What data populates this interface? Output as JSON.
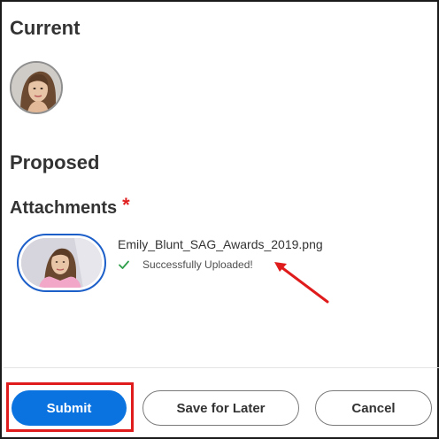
{
  "current": {
    "heading": "Current"
  },
  "proposed": {
    "heading": "Proposed"
  },
  "attachments": {
    "label": "Attachments",
    "required_marker": "*",
    "file_name": "Emily_Blunt_SAG_Awards_2019.png",
    "status": "Successfully Uploaded!"
  },
  "footer": {
    "submit_label": "Submit",
    "save_label": "Save for Later",
    "cancel_label": "Cancel"
  },
  "colors": {
    "primary": "#0b73e0",
    "highlight": "#e01b1b",
    "success": "#2e9e4a",
    "thumb_border": "#1d5fc9"
  },
  "icons": {
    "status": "check-icon",
    "annotation": "red-arrow"
  }
}
